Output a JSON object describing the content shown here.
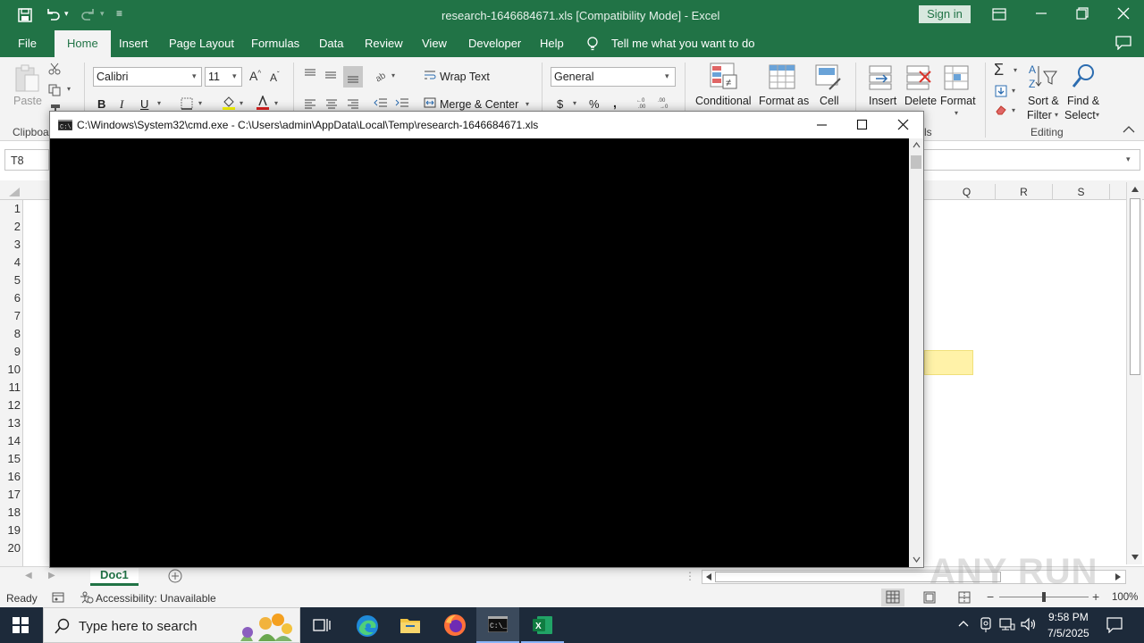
{
  "excel": {
    "window_title": "research-1646684671.xls  [Compatibility Mode]  -  Excel",
    "sign_in": "Sign in",
    "tabs": [
      "File",
      "Home",
      "Insert",
      "Page Layout",
      "Formulas",
      "Data",
      "Review",
      "View",
      "Developer",
      "Help"
    ],
    "active_tab": "Home",
    "tell_me": "Tell me what you want to do",
    "ribbon": {
      "paste": "Paste",
      "clipboard_group": "Clipboa",
      "font_name": "Calibri",
      "font_size": "11",
      "bold": "B",
      "italic": "I",
      "underline": "U",
      "wrap_text": "Wrap Text",
      "merge_center": "Merge & Center",
      "number_format": "General",
      "currency": "$",
      "percent": "%",
      "comma": ",",
      "conditional": "Conditional",
      "format_as": "Format as",
      "cell": "Cell",
      "insert": "Insert",
      "delete": "Delete",
      "format": "Format",
      "sort_filter_1": "Sort &",
      "sort_filter_2": "Filter",
      "find_select_1": "Find &",
      "find_select_2": "Select",
      "cells_group": "ls",
      "editing_group": "Editing"
    },
    "name_box": "T8",
    "columns": [
      "Q",
      "R",
      "S"
    ],
    "rows": [
      "1",
      "2",
      "3",
      "4",
      "5",
      "6",
      "7",
      "8",
      "9",
      "10",
      "11",
      "12",
      "13",
      "14",
      "15",
      "16",
      "17",
      "18",
      "19",
      "20"
    ],
    "sheet_tab": "Doc1",
    "status_ready": "Ready",
    "accessibility": "Accessibility: Unavailable",
    "zoom": "100%"
  },
  "cmd": {
    "title": "C:\\Windows\\System32\\cmd.exe - C:\\Users\\admin\\AppData\\Local\\Temp\\research-1646684671.xls"
  },
  "taskbar": {
    "search_placeholder": "Type here to search",
    "time": "9:58 PM",
    "date": "7/5/2025"
  },
  "watermark": "ANY RUN",
  "colors": {
    "excel_green": "#217346",
    "taskbar": "#1d2a3a",
    "highlight_cell": "#fff2a8"
  }
}
